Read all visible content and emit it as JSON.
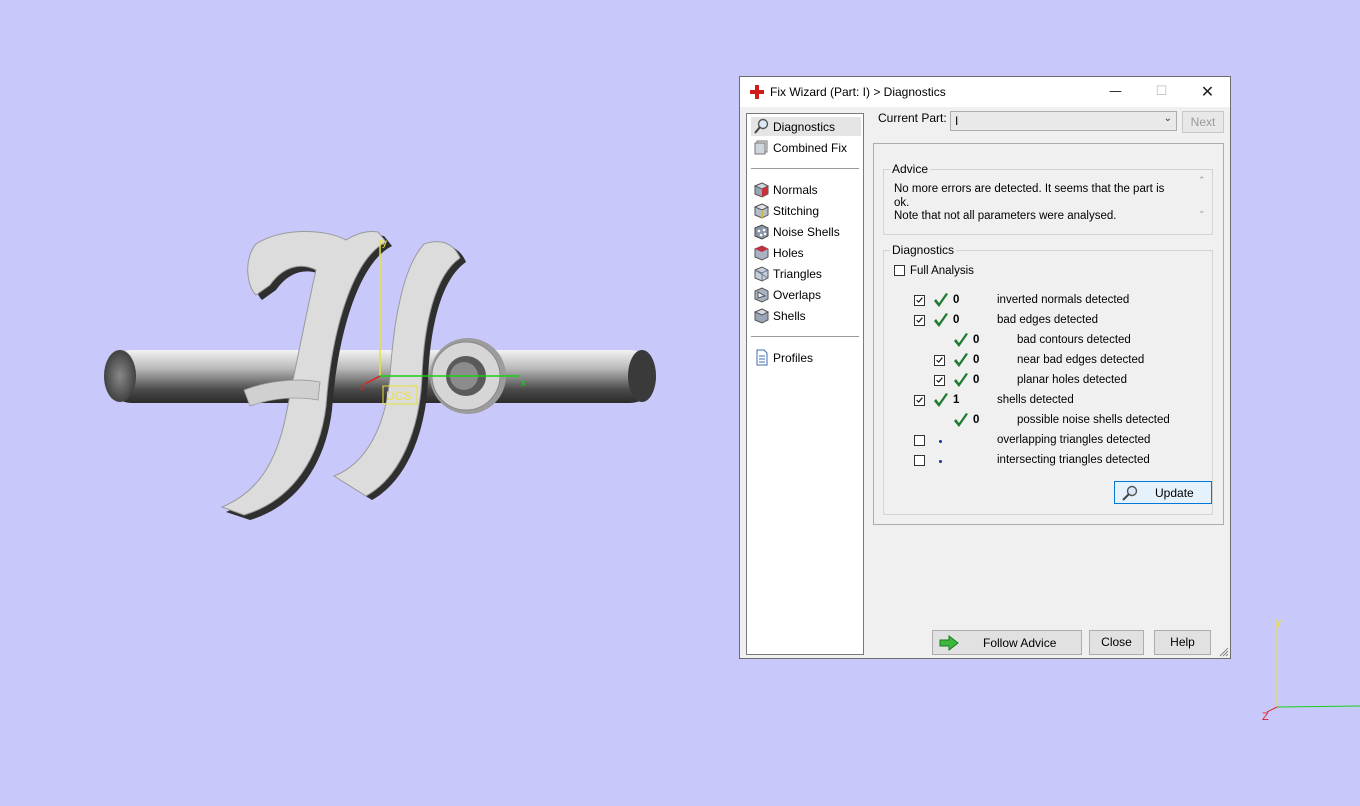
{
  "scene": {
    "ucs_label": "UCS",
    "local_axes": {
      "x": "x",
      "y": "y",
      "z": "z"
    },
    "triad": {
      "y": "Y",
      "z": "Z"
    }
  },
  "dialog": {
    "title": "Fix Wizard (Part: I) > Diagnostics",
    "nav": {
      "diagnostics": "Diagnostics",
      "combined_fix": "Combined Fix",
      "normals": "Normals",
      "stitching": "Stitching",
      "noise_shells": "Noise Shells",
      "holes": "Holes",
      "triangles": "Triangles",
      "overlaps": "Overlaps",
      "shells": "Shells",
      "profiles": "Profiles"
    },
    "current_part_label": "Current Part:",
    "current_part_value": "I",
    "next_button": "Next",
    "advice": {
      "title": "Advice",
      "line1": "No more errors are detected. It seems that the part is ok.",
      "line2": "Note that not all parameters were analysed."
    },
    "diagnostics": {
      "title": "Diagnostics",
      "full_analysis": "Full Analysis",
      "rows": [
        {
          "count": "0",
          "label": "inverted normals detected"
        },
        {
          "count": "0",
          "label": "bad edges detected"
        },
        {
          "count": "0",
          "label": "bad contours detected"
        },
        {
          "count": "0",
          "label": "near bad edges detected"
        },
        {
          "count": "0",
          "label": "planar holes detected"
        },
        {
          "count": "1",
          "label": "shells detected"
        },
        {
          "count": "0",
          "label": "possible noise shells detected"
        },
        {
          "count": "",
          "label": "overlapping triangles detected"
        },
        {
          "count": "",
          "label": "intersecting triangles detected"
        }
      ],
      "update_button": "Update"
    },
    "follow_advice_button": "Follow Advice",
    "close_button": "Close",
    "help_button": "Help"
  },
  "colors": {
    "background": "#c8c8fa",
    "check_green": "#1e7b32",
    "accent_blue": "#0078d7"
  }
}
